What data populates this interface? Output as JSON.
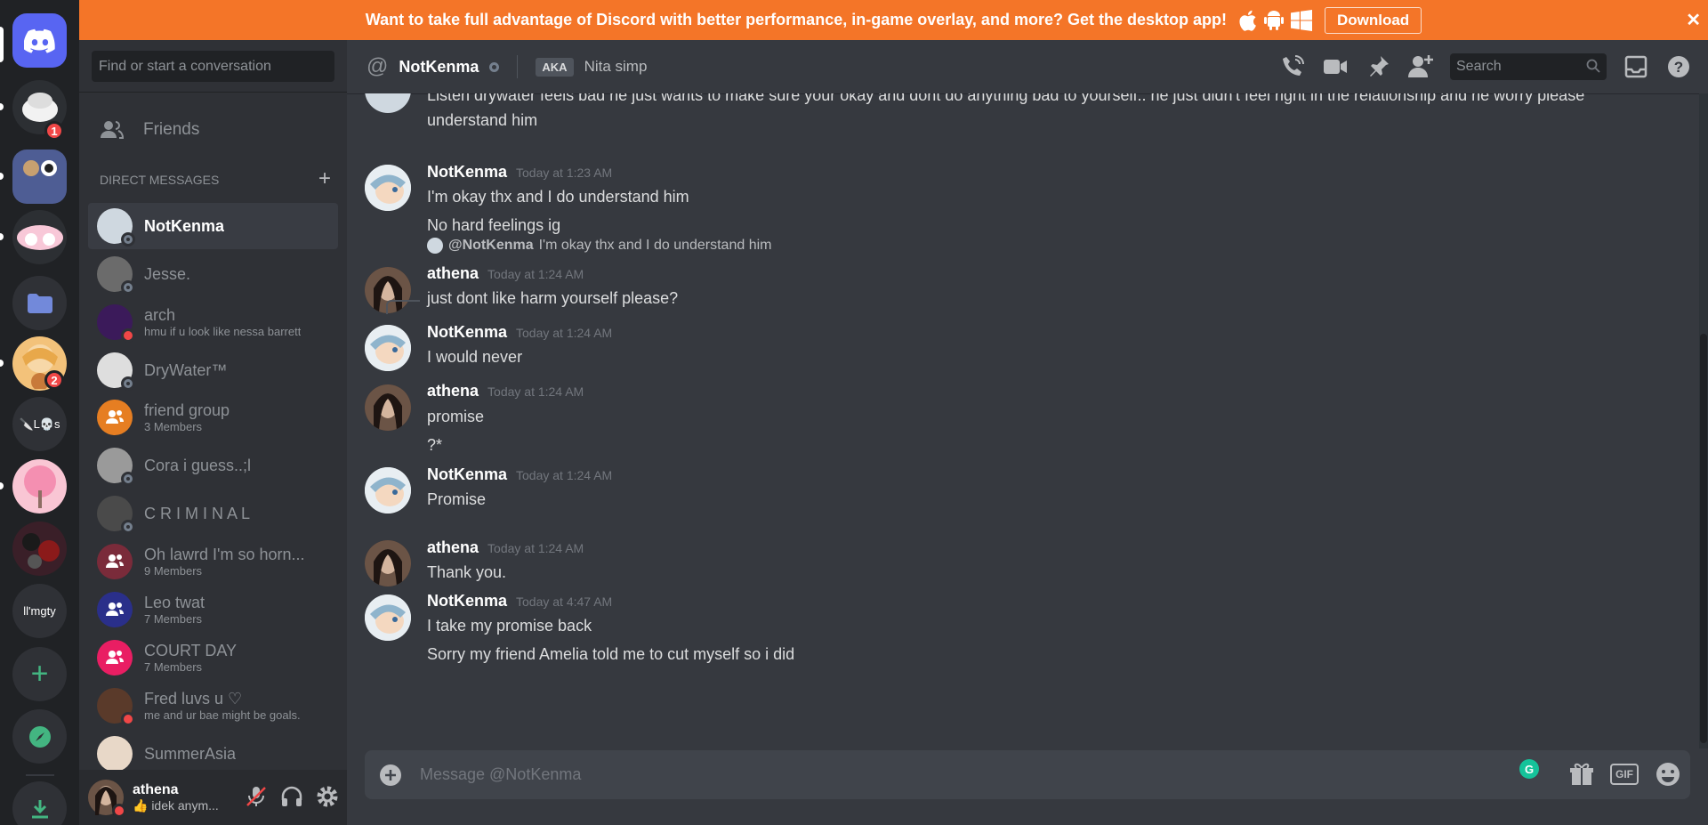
{
  "banner": {
    "text": "Want to take full advantage of Discord with better performance, in-game overlay, and more? Get the desktop app!",
    "download_label": "Download",
    "close": "✕"
  },
  "guilds": {
    "badge_1": "1",
    "badge_2": "2",
    "text_server_1": "🔪L💀s",
    "text_server_2": "ll'mgty",
    "icons": [
      "discord-home",
      "add-server",
      "explore",
      "download-apps"
    ]
  },
  "sidebar": {
    "search_placeholder": "Find or start a conversation",
    "friends_label": "Friends",
    "dm_header": "DIRECT MESSAGES",
    "dm_add": "+",
    "dms": [
      {
        "name": "NotKenma",
        "sub": "",
        "status": "offline",
        "color": "#cfd8e0"
      },
      {
        "name": "Jesse.",
        "sub": "",
        "status": "offline",
        "color": "#6b6b6b"
      },
      {
        "name": "arch",
        "sub": "hmu if u look like nessa barrett",
        "status": "dnd",
        "color": "#3b1a5a"
      },
      {
        "name": "DryWater™",
        "sub": "",
        "status": "offline",
        "color": "#dedede"
      },
      {
        "name": "friend group",
        "sub": "3 Members",
        "status": "",
        "color": "#e67e22"
      },
      {
        "name": "Cora i guess..;l",
        "sub": "",
        "status": "offline",
        "color": "#9a9a9a"
      },
      {
        "name": "C R I M I N A L",
        "sub": "",
        "status": "offline",
        "color": "#4a4a4a"
      },
      {
        "name": "Oh lawrd I'm so horn...",
        "sub": "9 Members",
        "status": "",
        "color": "#7a2b3a"
      },
      {
        "name": "Leo twat",
        "sub": "7 Members",
        "status": "",
        "color": "#2a2f8a"
      },
      {
        "name": "COURT DAY",
        "sub": "7 Members",
        "status": "",
        "color": "#e91e63"
      },
      {
        "name": "Fred luvs u ♡",
        "sub": "me and ur bae might be goals.",
        "status": "dnd",
        "color": "#5a3a2a"
      },
      {
        "name": "SummerAsia",
        "sub": "",
        "status": "",
        "color": "#e8d8c8"
      }
    ],
    "user": {
      "name": "athena",
      "status": "👍 idek anym...",
      "status_color": "#f04747"
    }
  },
  "header": {
    "at": "@",
    "name": "NotKenma",
    "aka": "AKA",
    "nick": "Nita simp",
    "search_placeholder": "Search"
  },
  "messages": {
    "top_partial_1": "Listen drywater feels bad he just wants to make sure your okay and dont do anything bad to yourself.. he just didn't feel right in the relationship and he worry please",
    "top_partial_2": "understand him",
    "groups": [
      {
        "author": "NotKenma",
        "time": "Today at 1:23 AM",
        "lines": [
          "I'm okay thx and I do understand him",
          "No hard feelings ig"
        ]
      },
      {
        "author": "athena",
        "time": "Today at 1:24 AM",
        "reply_to": "@NotKenma",
        "reply_text": "I'm okay thx and I do understand him",
        "lines": [
          "just dont like harm yourself please?"
        ]
      },
      {
        "author": "NotKenma",
        "time": "Today at 1:24 AM",
        "lines": [
          "I would never"
        ]
      },
      {
        "author": "athena",
        "time": "Today at 1:24 AM",
        "lines": [
          "promise",
          "?*"
        ]
      },
      {
        "author": "NotKenma",
        "time": "Today at 1:24 AM",
        "lines": [
          "Promise"
        ]
      },
      {
        "author": "athena",
        "time": "Today at 1:24 AM",
        "lines": [
          "Thank you."
        ]
      },
      {
        "author": "NotKenma",
        "time": "Today at 4:47 AM",
        "lines": [
          "I take my promise back",
          "Sorry my friend Amelia told me to cut myself so i did"
        ]
      }
    ]
  },
  "composer": {
    "placeholder": "Message @NotKenma",
    "gif_label": "GIF",
    "grammarly_label": "G"
  }
}
